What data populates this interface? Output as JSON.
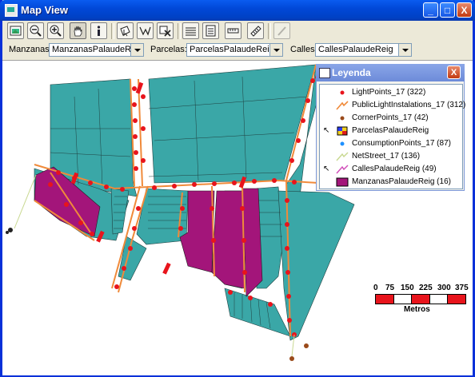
{
  "window": {
    "title": "Map View",
    "minimize": "_",
    "maximize": "□",
    "close": "X"
  },
  "toolbar": {
    "buttons": [
      {
        "name": "full-extent-icon",
        "tooltip": "Full extent"
      },
      {
        "name": "zoom-out-icon"
      },
      {
        "name": "zoom-in-icon"
      },
      {
        "name": "pan-hand-icon",
        "pressed": true
      },
      {
        "name": "info-icon"
      },
      {
        "name": "select-icon"
      },
      {
        "name": "select-polygon-icon"
      },
      {
        "name": "clear-selection-icon"
      },
      {
        "name": "layers-icon"
      },
      {
        "name": "table-icon"
      },
      {
        "name": "measure-icon"
      },
      {
        "name": "ruler-icon"
      },
      {
        "name": "pencil-icon",
        "disabled": true
      }
    ]
  },
  "layers": {
    "manzanas_label": "Manzanas:",
    "manzanas_value": "ManzanasPalaudeReig",
    "parcelas_label": "Parcelas:",
    "parcelas_value": "ParcelasPalaudeReig",
    "calles_label": "Calles:",
    "calles_value": "CallesPalaudeReig"
  },
  "legend": {
    "title": "Leyenda",
    "close": "X",
    "items": [
      {
        "label": "LightPoints_17  (322)",
        "symbol": "dot",
        "color": "#e8141c"
      },
      {
        "label": "PublicLightInstalations_17  (312)",
        "symbol": "line",
        "color": "#f08a3a"
      },
      {
        "label": "CornerPoints_17  (42)",
        "symbol": "dot",
        "color": "#9a4a1a"
      },
      {
        "label": "ParcelasPalaudeReig",
        "symbol": "multi",
        "pointer": true
      },
      {
        "label": "ConsumptionPoints_17  (87)",
        "symbol": "dot",
        "color": "#1e90ff"
      },
      {
        "label": "NetStreet_17  (136)",
        "symbol": "line",
        "color": "#c8d890"
      },
      {
        "label": "CallesPalaudeReig  (49)",
        "symbol": "line",
        "color": "#d04ab8",
        "pointer": true
      },
      {
        "label": "ManzanasPalaudeReig  (16)",
        "symbol": "fill",
        "color": "#a3157a"
      }
    ]
  },
  "scale": {
    "ticks": [
      "0",
      "75",
      "150",
      "225",
      "300",
      "375"
    ],
    "unit": "Metros"
  },
  "colors": {
    "parcel": "#3aa7a7",
    "block": "#a3157a",
    "street": "#f08a3a",
    "light": "#e8141c"
  }
}
